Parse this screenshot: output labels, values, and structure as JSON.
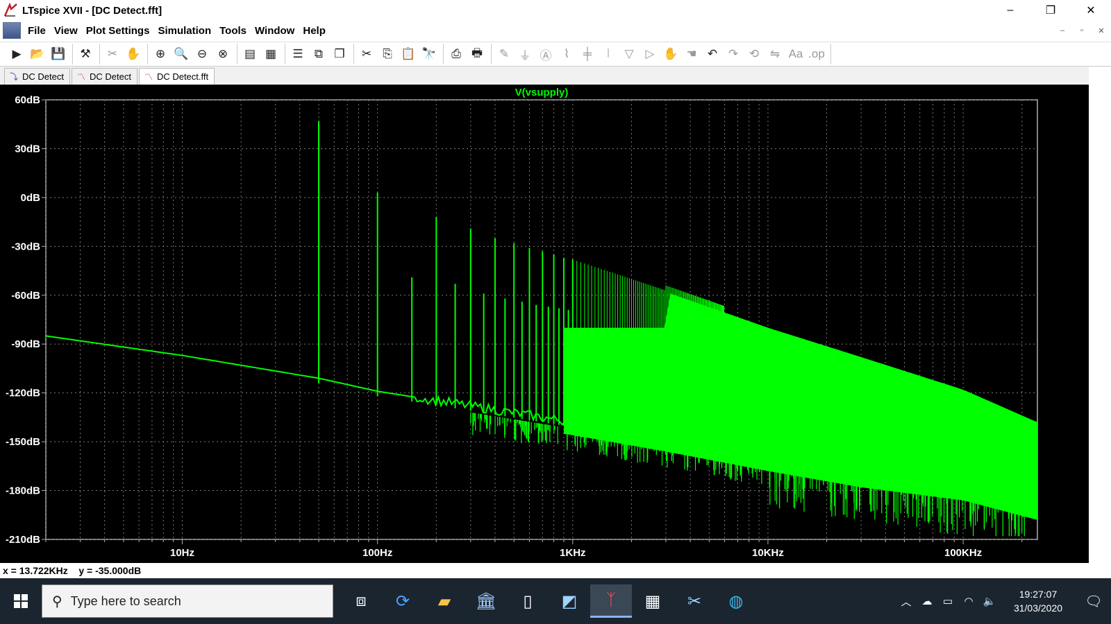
{
  "window": {
    "title": "LTspice XVII - [DC Detect.fft]",
    "controls": [
      "–",
      "❐",
      "✕"
    ]
  },
  "menu": {
    "items": [
      "File",
      "View",
      "Plot Settings",
      "Simulation",
      "Tools",
      "Window",
      "Help"
    ],
    "mdi_controls": [
      "–",
      "▫",
      "✕"
    ]
  },
  "toolbar": {
    "groups": [
      [
        "run-icon",
        "open-icon",
        "save-icon"
      ],
      [
        "control-panel-icon"
      ],
      [
        "probe-icon",
        "pan-icon"
      ],
      [
        "zoom-in-icon",
        "zoom-area-icon",
        "zoom-out-icon",
        "zoom-fit-icon"
      ],
      [
        "autorange-icon",
        "tile-icon"
      ],
      [
        "tile-horizontal-icon",
        "tile-vertical-icon",
        "cascade-icon"
      ],
      [
        "cut-icon",
        "copy-icon",
        "paste-icon",
        "find-icon"
      ],
      [
        "print-icon",
        "print-setup-icon"
      ],
      [
        "wire-icon",
        "ground-icon",
        "label-icon",
        "resistor-icon",
        "capacitor-icon",
        "inductor-icon",
        "diode-icon",
        "component-icon",
        "move-icon",
        "drag-icon",
        "undo-icon",
        "redo-icon",
        "rotate-icon",
        "mirror-icon",
        "text-icon",
        "spice-directive-icon"
      ]
    ]
  },
  "tabs": [
    {
      "label": "DC Detect",
      "icon": "schematic-icon",
      "active": false
    },
    {
      "label": "DC Detect",
      "icon": "waveform-icon",
      "active": false
    },
    {
      "label": "DC Detect.fft",
      "icon": "fft-icon",
      "active": true
    }
  ],
  "status": {
    "cursor_readout": "x = 13.722KHz    y = -35.000dB"
  },
  "taskbar": {
    "search_placeholder": "Type here to search",
    "apps": [
      "task-view-icon",
      "sync-icon",
      "file-explorer-icon",
      "bank-icon",
      "file-icon",
      "notepad-icon",
      "ltspice-icon",
      "calculator-icon",
      "snipping-tool-icon",
      "edge-icon"
    ],
    "active_app": "ltspice-icon",
    "time": "19:27:07",
    "date": "31/03/2020"
  },
  "chart_data": {
    "type": "line",
    "title": "V(vsupply)",
    "xlabel": "",
    "ylabel": "",
    "x_scale": "log",
    "xlim": [
      2,
      240000
    ],
    "ylim": [
      -210,
      60
    ],
    "x_ticks": [
      {
        "value": 10,
        "label": "10Hz"
      },
      {
        "value": 100,
        "label": "100Hz"
      },
      {
        "value": 1000,
        "label": "1KHz"
      },
      {
        "value": 10000,
        "label": "10KHz"
      },
      {
        "value": 100000,
        "label": "100KHz"
      }
    ],
    "y_ticks": [
      {
        "value": 60,
        "label": "60dB"
      },
      {
        "value": 30,
        "label": "30dB"
      },
      {
        "value": 0,
        "label": "0dB"
      },
      {
        "value": -30,
        "label": "-30dB"
      },
      {
        "value": -60,
        "label": "-60dB"
      },
      {
        "value": -90,
        "label": "-90dB"
      },
      {
        "value": -120,
        "label": "-120dB"
      },
      {
        "value": -150,
        "label": "-150dB"
      },
      {
        "value": -180,
        "label": "-180dB"
      },
      {
        "value": -210,
        "label": "-210dB"
      }
    ],
    "grid": true,
    "series": [
      {
        "name": "V(vsupply)",
        "color": "#00ff00",
        "noise_floor": [
          {
            "x": 2,
            "y": -85
          },
          {
            "x": 10,
            "y": -97
          },
          {
            "x": 50,
            "y": -111
          },
          {
            "x": 100,
            "y": -119
          },
          {
            "x": 300,
            "y": -128
          },
          {
            "x": 1000,
            "y": -138
          },
          {
            "x": 3000,
            "y": -148
          },
          {
            "x": 10000,
            "y": -160
          },
          {
            "x": 30000,
            "y": -170
          },
          {
            "x": 100000,
            "y": -178
          },
          {
            "x": 240000,
            "y": -190
          }
        ],
        "upper_envelope": [
          {
            "x": 3000,
            "y": -58
          },
          {
            "x": 10000,
            "y": -80
          },
          {
            "x": 30000,
            "y": -98
          },
          {
            "x": 100000,
            "y": -118
          },
          {
            "x": 240000,
            "y": -138
          }
        ],
        "harmonics": [
          {
            "x": 50,
            "y": 47
          },
          {
            "x": 100,
            "y": 3
          },
          {
            "x": 150,
            "y": -49
          },
          {
            "x": 200,
            "y": -12
          },
          {
            "x": 250,
            "y": -53
          },
          {
            "x": 300,
            "y": -19
          },
          {
            "x": 350,
            "y": -59
          },
          {
            "x": 400,
            "y": -25
          },
          {
            "x": 450,
            "y": -62
          },
          {
            "x": 500,
            "y": -28
          },
          {
            "x": 550,
            "y": -64
          },
          {
            "x": 600,
            "y": -31
          },
          {
            "x": 650,
            "y": -66
          },
          {
            "x": 700,
            "y": -33
          },
          {
            "x": 750,
            "y": -67
          },
          {
            "x": 800,
            "y": -35
          },
          {
            "x": 850,
            "y": -68
          },
          {
            "x": 900,
            "y": -37
          },
          {
            "x": 950,
            "y": -69
          },
          {
            "x": 1000,
            "y": -38
          }
        ]
      }
    ]
  }
}
